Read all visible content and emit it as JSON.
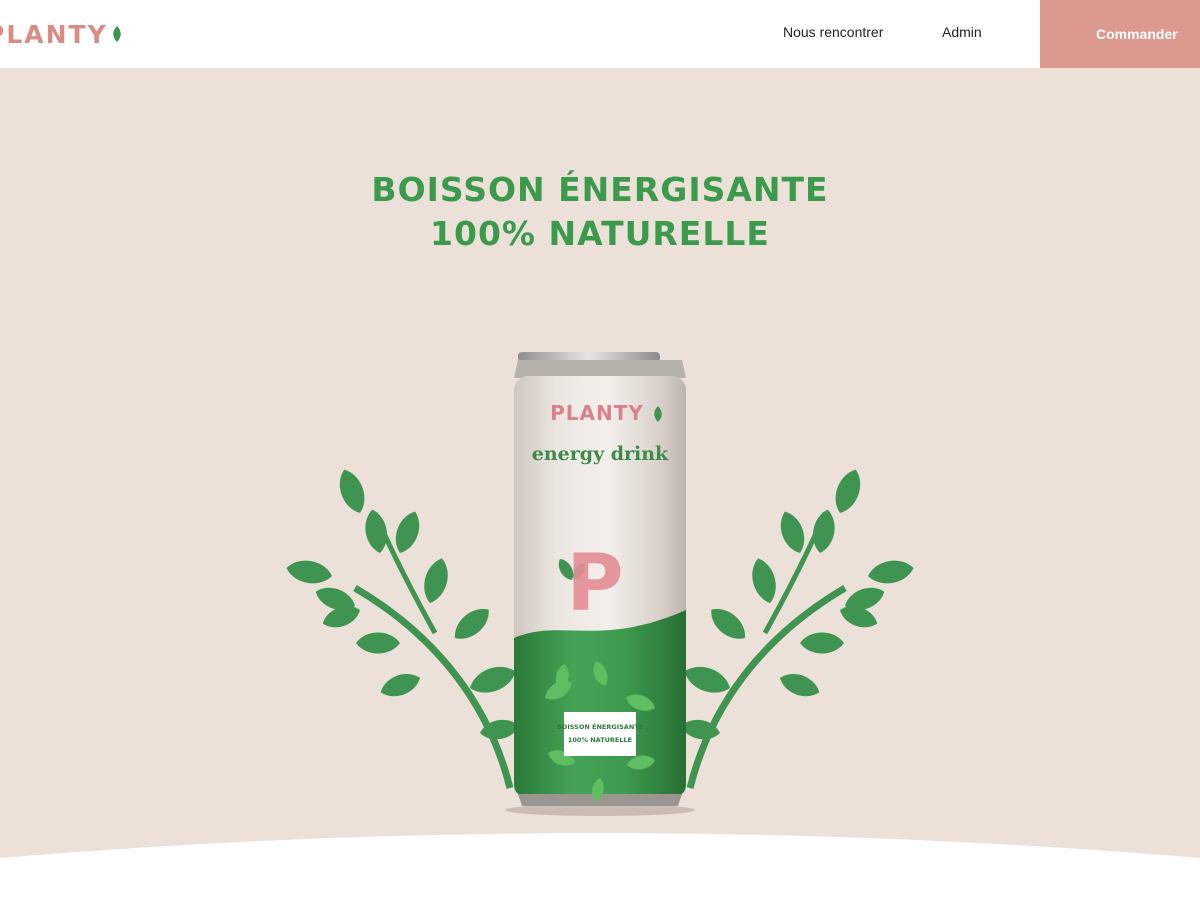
{
  "header": {
    "logo_text": "PLANTY",
    "logo_icon": "leaf-icon",
    "nav": [
      {
        "label": "Nous rencontrer"
      },
      {
        "label": "Admin"
      }
    ],
    "cta_label": "Commander"
  },
  "hero": {
    "title_line1": "BOISSON ÉNERGISANTE",
    "title_line2": "100% NATURELLE",
    "can": {
      "brand": "PLANTY",
      "tagline": "energy drink",
      "letter": "P",
      "label_line1": "BOISSON ÉNERGISANTE",
      "label_line2": "100% NATURELLE"
    }
  },
  "colors": {
    "accent_pink": "#dc998f",
    "brand_green": "#3c9a4c",
    "leaf_green": "#3e9450",
    "hero_background": "#ebe1d9"
  }
}
